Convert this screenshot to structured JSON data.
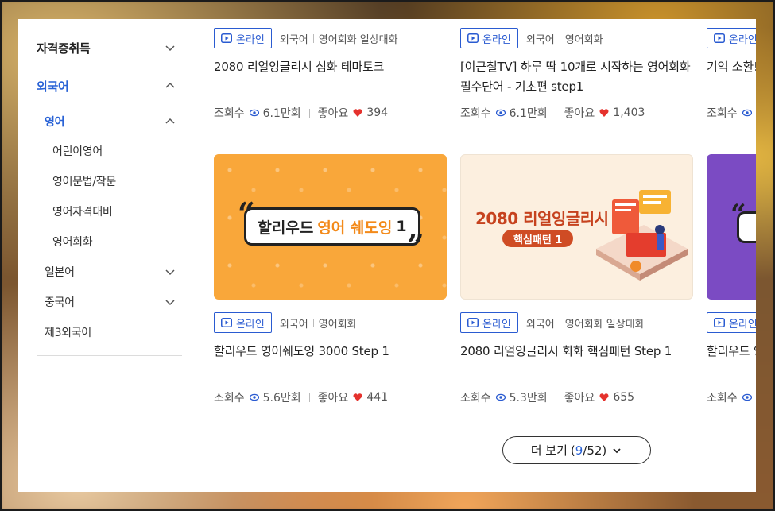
{
  "sidebar": {
    "categories": [
      {
        "label": "자격증취득",
        "expanded": false
      },
      {
        "label": "외국어",
        "expanded": true
      }
    ],
    "sub": [
      {
        "label": "영어",
        "expanded": true
      },
      {
        "label": "일본어",
        "expanded": false
      },
      {
        "label": "중국어",
        "expanded": false
      },
      {
        "label": "제3외국어",
        "expanded": false
      }
    ],
    "leaves": [
      "어린이영어",
      "영어문법/작문",
      "영어자격대비",
      "영어회화"
    ]
  },
  "cards": [
    {
      "badge": "온라인",
      "crumb1": "외국어",
      "crumb2": "영어회화 일상대화",
      "title": "2080 리얼잉글리시 심화 테마토크",
      "views_label": "조회수",
      "views": "6.1만회",
      "likes_label": "좋아요",
      "likes": "394"
    },
    {
      "badge": "온라인",
      "crumb1": "외국어",
      "crumb2": "영어회화",
      "title": "[이근철TV] 하루 딱 10개로 시작하는 영어회화 필수단어 - 기초편 step1",
      "views_label": "조회수",
      "views": "6.1만회",
      "likes_label": "좋아요",
      "likes": "1,403"
    },
    {
      "badge": "온라인",
      "crumb1": "",
      "crumb2": "",
      "title": "기억 소환!",
      "views_label": "조회수",
      "views": "",
      "likes_label": "",
      "likes": ""
    },
    {
      "thumb_text_a": "할리우드",
      "thumb_text_b": "영어 쉐도잉",
      "thumb_text_c": "1",
      "badge": "온라인",
      "crumb1": "외국어",
      "crumb2": "영어회화",
      "title": "할리우드 영어쉐도잉 3000 Step 1",
      "views_label": "조회수",
      "views": "5.6만회",
      "likes_label": "좋아요",
      "likes": "441"
    },
    {
      "thumb_text_a": "2080 리얼잉글리시",
      "thumb_text_b": "핵심패턴 1",
      "badge": "온라인",
      "crumb1": "외국어",
      "crumb2": "영어회화 일상대화",
      "title": "2080 리얼잉글리시 회화 핵심패턴 Step 1",
      "views_label": "조회수",
      "views": "5.3만회",
      "likes_label": "좋아요",
      "likes": "655"
    },
    {
      "badge": "온라인",
      "crumb1": "",
      "crumb2": "",
      "title": "할리우드 양",
      "views_label": "조회수",
      "views": "",
      "likes_label": "",
      "likes": ""
    }
  ],
  "more": {
    "label": "더 보기",
    "current": "9",
    "total": "/52"
  },
  "colors": {
    "accent": "#2a63d6",
    "badge": "#2a5bd1",
    "heart": "#e5322d"
  }
}
